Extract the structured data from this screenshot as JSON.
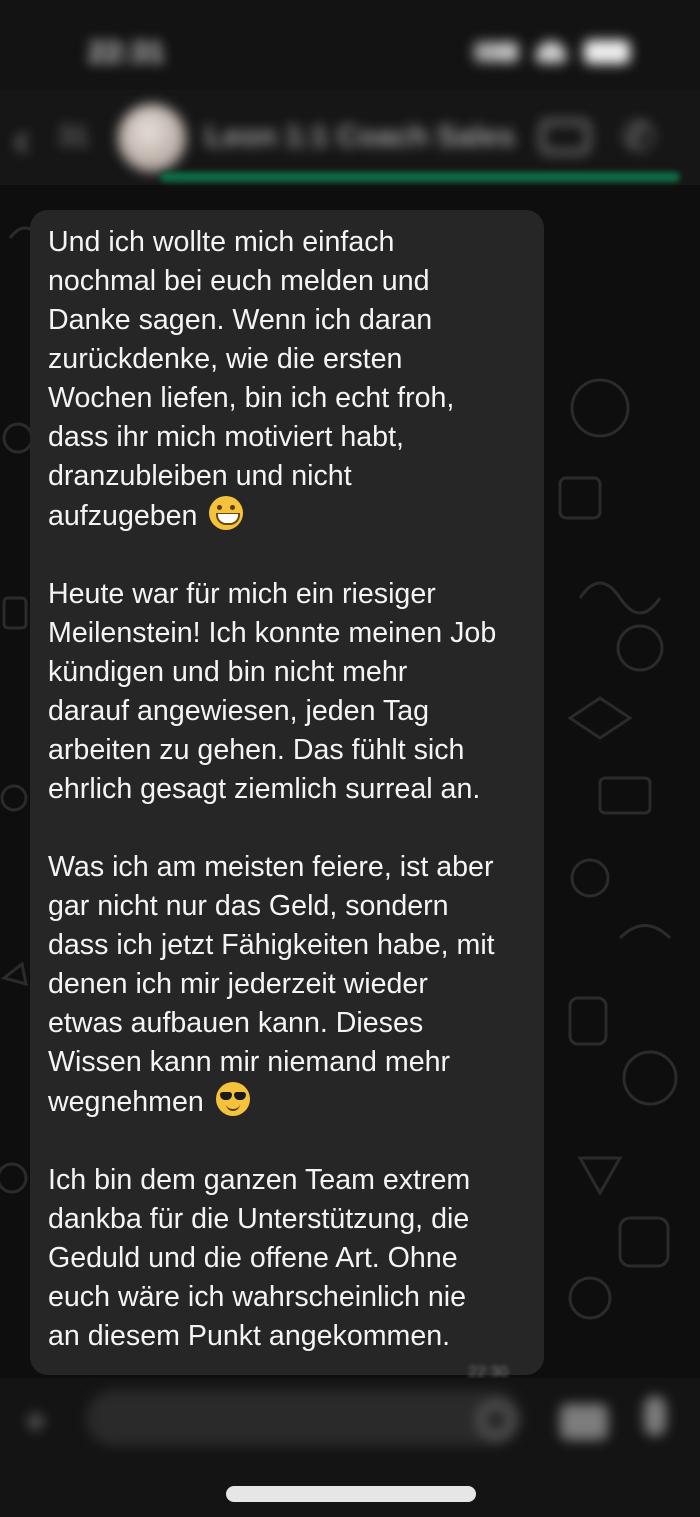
{
  "status_bar": {
    "time": "22:31"
  },
  "header": {
    "unread_count": "31",
    "contact_name": "Leon 1:1 Coach Sales"
  },
  "message": {
    "paragraphs": [
      "Und ich wollte mich einfach\nnochmal bei euch melden und\nDanke sagen. Wenn ich daran\nzurückdenke, wie die ersten\nWochen liefen, bin ich echt froh,\ndass ihr mich motiviert habt,\ndranzubleiben und nicht\naufzugeben",
      "Heute war für mich ein riesiger\nMeilenstein! Ich konnte meinen Job\nkündigen und bin nicht mehr\ndarauf angewiesen, jeden Tag\narbeiten zu gehen. Das fühlt sich\nehrlich gesagt ziemlich surreal an.",
      "Was ich am meisten feiere, ist aber\ngar nicht nur das Geld, sondern\ndass ich jetzt Fähigkeiten habe, mit\ndenen ich mir jederzeit wieder\netwas aufbauen kann. Dieses\nWissen kann mir niemand mehr\nwegnehmen",
      "Ich bin dem ganzen Team extrem\ndankba für die Unterstützung, die\nGeduld und die offene Art. Ohne\neuch wäre ich wahrscheinlich nie\nan diesem Punkt angekommen."
    ],
    "emojis": [
      "grinning-face-emoji",
      "sunglasses-face-emoji"
    ],
    "timestamp": "22:30"
  },
  "colors": {
    "bubble": "#262626",
    "background": "#0e0e0e",
    "accent_green": "#0d6e45",
    "text": "#f4f4f4"
  },
  "icons": [
    "back-icon",
    "video-call-icon",
    "phone-call-icon",
    "plus-icon",
    "sticker-icon",
    "camera-icon",
    "microphone-icon"
  ]
}
